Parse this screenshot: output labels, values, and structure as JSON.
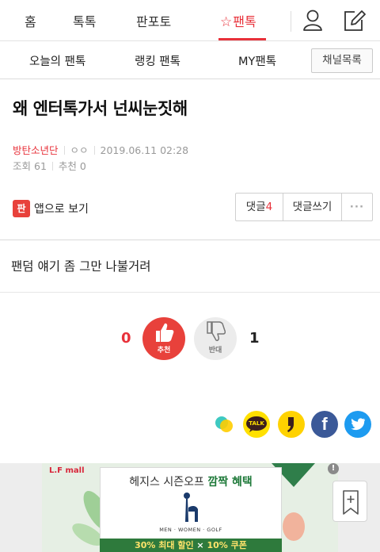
{
  "nav": {
    "tabs": [
      "홈",
      "톡톡",
      "판포토",
      "팬톡"
    ],
    "active_tab_star": "☆",
    "accent": "#e8313a"
  },
  "subnav": {
    "items": [
      "오늘의 팬톡",
      "랭킹 팬톡",
      "MY팬톡"
    ],
    "channel_list": "채널목록"
  },
  "post": {
    "title": "왜 엔터톡가서 넌씨눈짓해",
    "author": "방탄소년단",
    "author_extra": "ㅇㅇ",
    "datetime": "2019.06.11 02:28",
    "views_label": "조회",
    "views": "61",
    "recommend_label": "추천",
    "recommend": "0",
    "body": "팬덤 얘기 좀 그만 나불거려"
  },
  "actions": {
    "app_icon_text": "판",
    "app_view": "앱으로 보기",
    "comments_label": "댓글",
    "comments_count": "4",
    "write_comment": "댓글쓰기",
    "more": "···"
  },
  "vote": {
    "up_count": "0",
    "up_label": "추천",
    "down_label": "반대",
    "down_count": "1"
  },
  "share": {
    "icons": [
      "story-icon",
      "kakaotalk-icon",
      "kakaostory-icon",
      "facebook-icon",
      "twitter-icon"
    ],
    "talk_text": "TALK",
    "facebook_text": "f"
  },
  "ad": {
    "brand": "L.F mall",
    "headline_plain": "헤지스 시즌오프",
    "headline_highlight": "깜짝 혜택",
    "subline": "MEN · WOMEN · GOLF",
    "offer_a": "30% 최대 할인",
    "offer_sep": "×",
    "offer_b": "10% 쿠폰",
    "info": "!"
  }
}
